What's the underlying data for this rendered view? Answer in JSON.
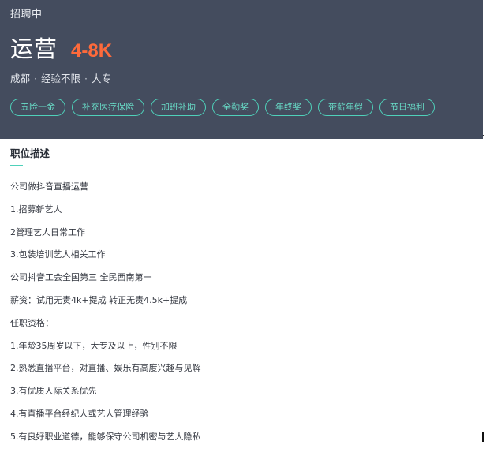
{
  "header": {
    "status": "招聘中",
    "job_title": "运营",
    "salary": "4-8K",
    "location": "成都",
    "experience": "经验不限",
    "education": "大专",
    "separator": "·",
    "tags": [
      "五险一金",
      "补充医疗保险",
      "加班补助",
      "全勤奖",
      "年终奖",
      "带薪年假",
      "节日福利"
    ]
  },
  "description": {
    "title": "职位描述",
    "lines": [
      "公司做抖音直播运营",
      "1.招募新艺人",
      "2管理艺人日常工作",
      "3.包装培训艺人相关工作",
      "公司抖音工会全国第三 全民西南第一",
      "薪资：试用无责4k+提成 转正无责4.5k+提成",
      "任职资格：",
      "1.年龄35周岁以下，大专及以上，性别不限",
      "2.熟悉直播平台，对直播、娱乐有高度兴趣与见解",
      "3.有优质人际关系优先",
      "4.有直播平台经纪人或艺人管理经验",
      "5.有良好职业道德，能够保守公司机密与艺人隐私"
    ]
  },
  "colors": {
    "header_bg": "#444c5e",
    "salary": "#fe6a3b",
    "accent": "#4fd1ba"
  }
}
